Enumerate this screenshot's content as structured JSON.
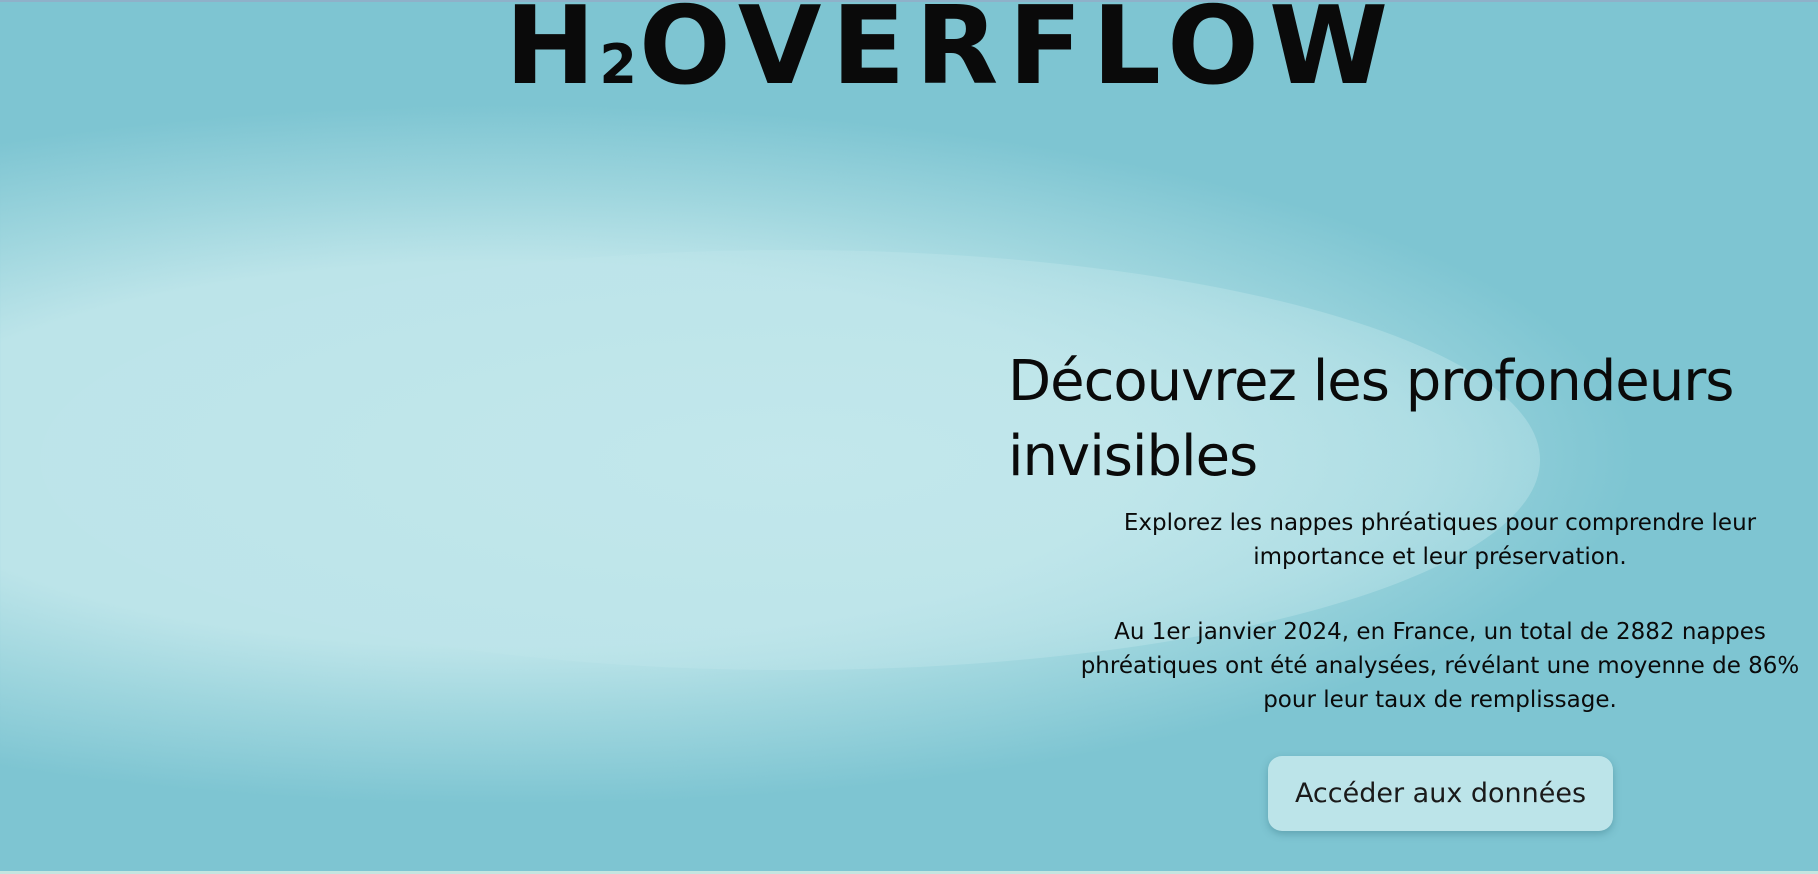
{
  "brand": {
    "logo_prefix": "H",
    "logo_subscript": "2",
    "logo_suffix": "OVERFLOW"
  },
  "hero": {
    "headline": "Découvrez les profondeurs invisibles",
    "intro_line1": "Explorez les nappes phréatiques pour comprendre leur",
    "intro_line2": "importance et leur préservation.",
    "stats_line1": "Au 1er janvier 2024, en France, un total de 2882 nappes",
    "stats_line2": "phréatiques ont été analysées, révélant une moyenne de 86%",
    "stats_line3": "pour leur taux de remplissage.",
    "cta_label": "Accéder aux données"
  },
  "colors": {
    "background_edge": "#7ec5d2",
    "background_center": "#bce4e9",
    "button_background": "#bce4e9",
    "text": "#0a0a0a"
  }
}
